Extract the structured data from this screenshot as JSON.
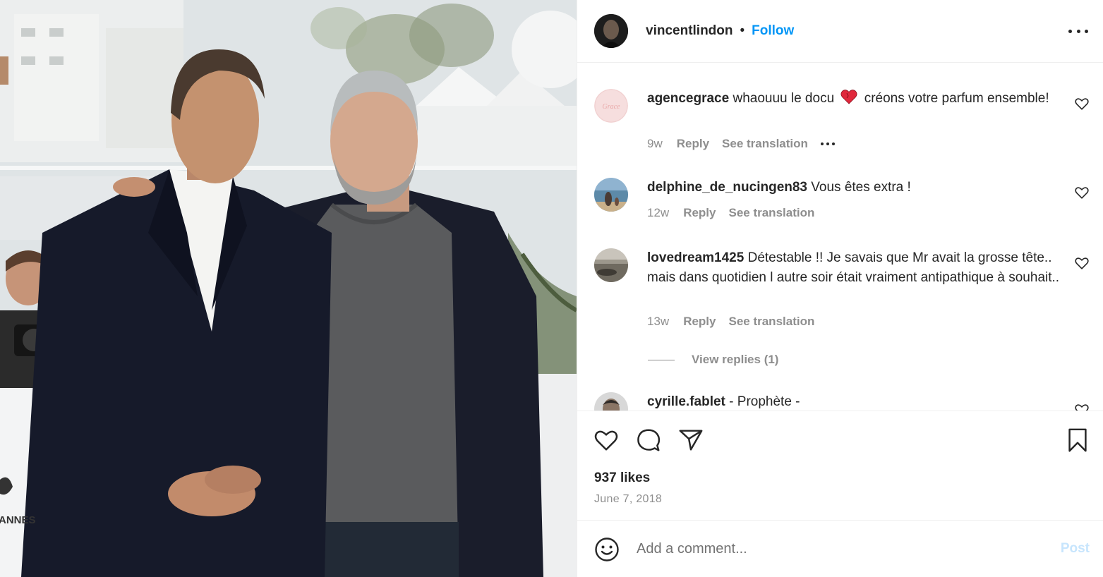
{
  "post": {
    "author": "vincentlindon",
    "separator": "•",
    "follow_label": "Follow",
    "likes": "937 likes",
    "date": "June 7, 2018",
    "add_comment_placeholder": "Add a comment...",
    "post_label": "Post"
  },
  "photo": {
    "backdrop_text": "ANNES"
  },
  "comments": [
    {
      "user": "agencegrace",
      "avatar_text": "Grace",
      "text_before": "whaouuu le docu",
      "emoji": "heart",
      "text_after": "créons votre parfum ensemble!",
      "time": "9w",
      "reply": "Reply",
      "translate": "See translation"
    },
    {
      "user": "delphine_de_nucingen83",
      "text": "Vous êtes extra !",
      "time": "12w",
      "reply": "Reply",
      "translate": "See translation"
    },
    {
      "user": "lovedream1425",
      "text": "Détestable !! Je savais que Mr avait la grosse tête.. mais dans quotidien l autre soir était vraiment antipathique à souhait..",
      "time": "13w",
      "reply": "Reply",
      "translate": "See translation",
      "view_replies": "View replies (1)"
    },
    {
      "user": "cyrille.fablet",
      "text": "- Prophète -"
    }
  ],
  "colors": {
    "accent": "#0095f6",
    "text": "#262626",
    "muted": "#8e8e8e",
    "post_disabled": "#c7e5fd",
    "emoji_heart": "#e0283c"
  },
  "icons": {
    "header_more": "more-horizontal-icon",
    "comment_like": "heart-outline-icon",
    "like": "heart-outline-icon",
    "comment": "comment-bubble-icon",
    "share": "paper-plane-icon",
    "save": "bookmark-icon",
    "emoji": "smiley-icon"
  }
}
